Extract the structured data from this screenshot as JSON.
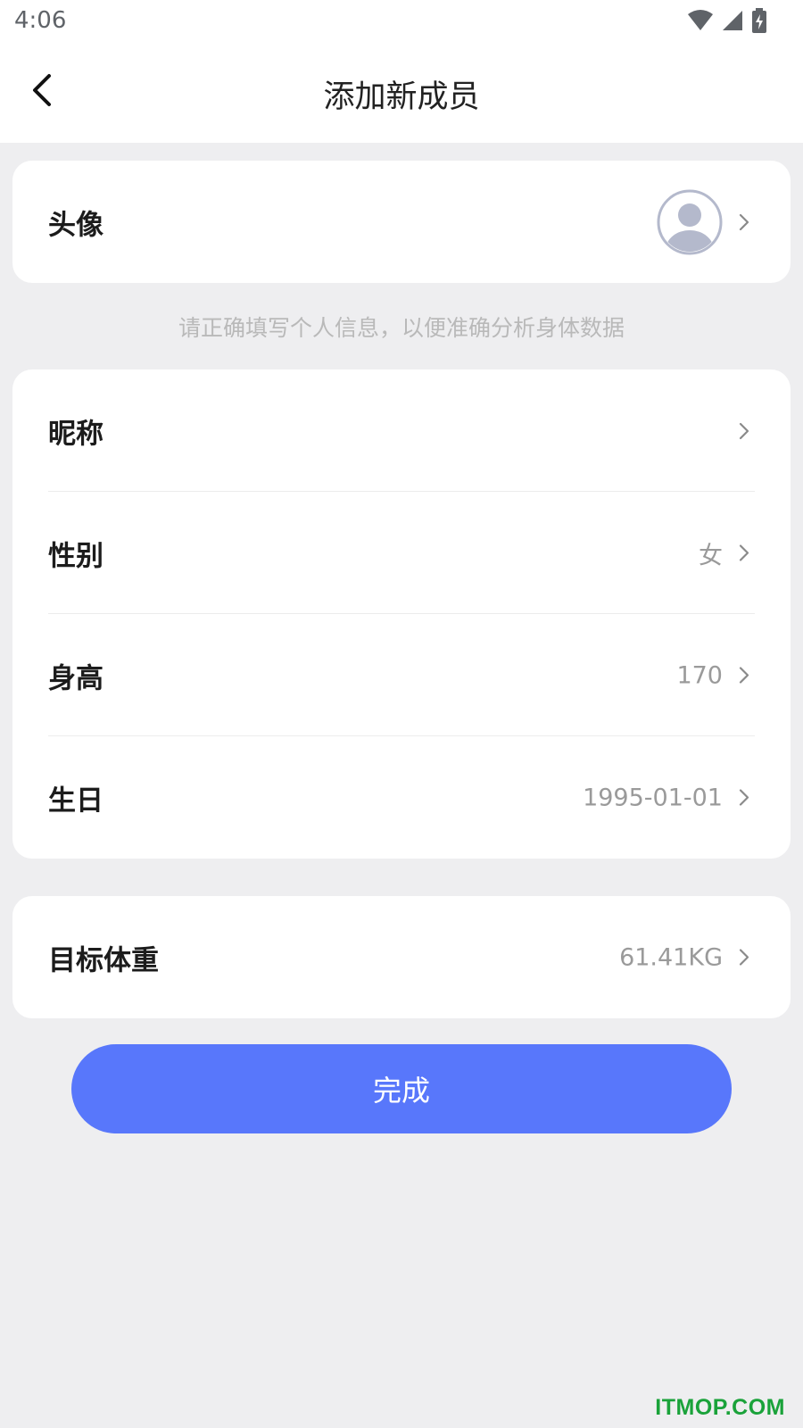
{
  "status_bar": {
    "time": "4:06",
    "icons": [
      "wifi-icon",
      "cellular-signal-icon",
      "battery-charging-icon"
    ]
  },
  "nav": {
    "title": "添加新成员",
    "back_icon": "back-chevron-icon"
  },
  "avatar_card": {
    "label": "头像",
    "avatar_icon": "default-avatar-icon"
  },
  "hint": "请正确填写个人信息，以便准确分析身体数据",
  "profile_card": {
    "rows": [
      {
        "label": "昵称",
        "value": ""
      },
      {
        "label": "性别",
        "value": "女"
      },
      {
        "label": "身高",
        "value": "170"
      },
      {
        "label": "生日",
        "value": "1995-01-01"
      }
    ]
  },
  "target_card": {
    "label": "目标体重",
    "value": "61.41KG"
  },
  "done_button": {
    "label": "完成"
  },
  "watermark": "ITMOP.COM",
  "colors": {
    "accent": "#5877fb",
    "page_background": "#eeeef0",
    "card_background": "#ffffff",
    "value_text": "#9a9a9a",
    "hint_text": "#b9b9b9",
    "avatar": "#b4b9cc",
    "watermark": "#1aa23a"
  }
}
